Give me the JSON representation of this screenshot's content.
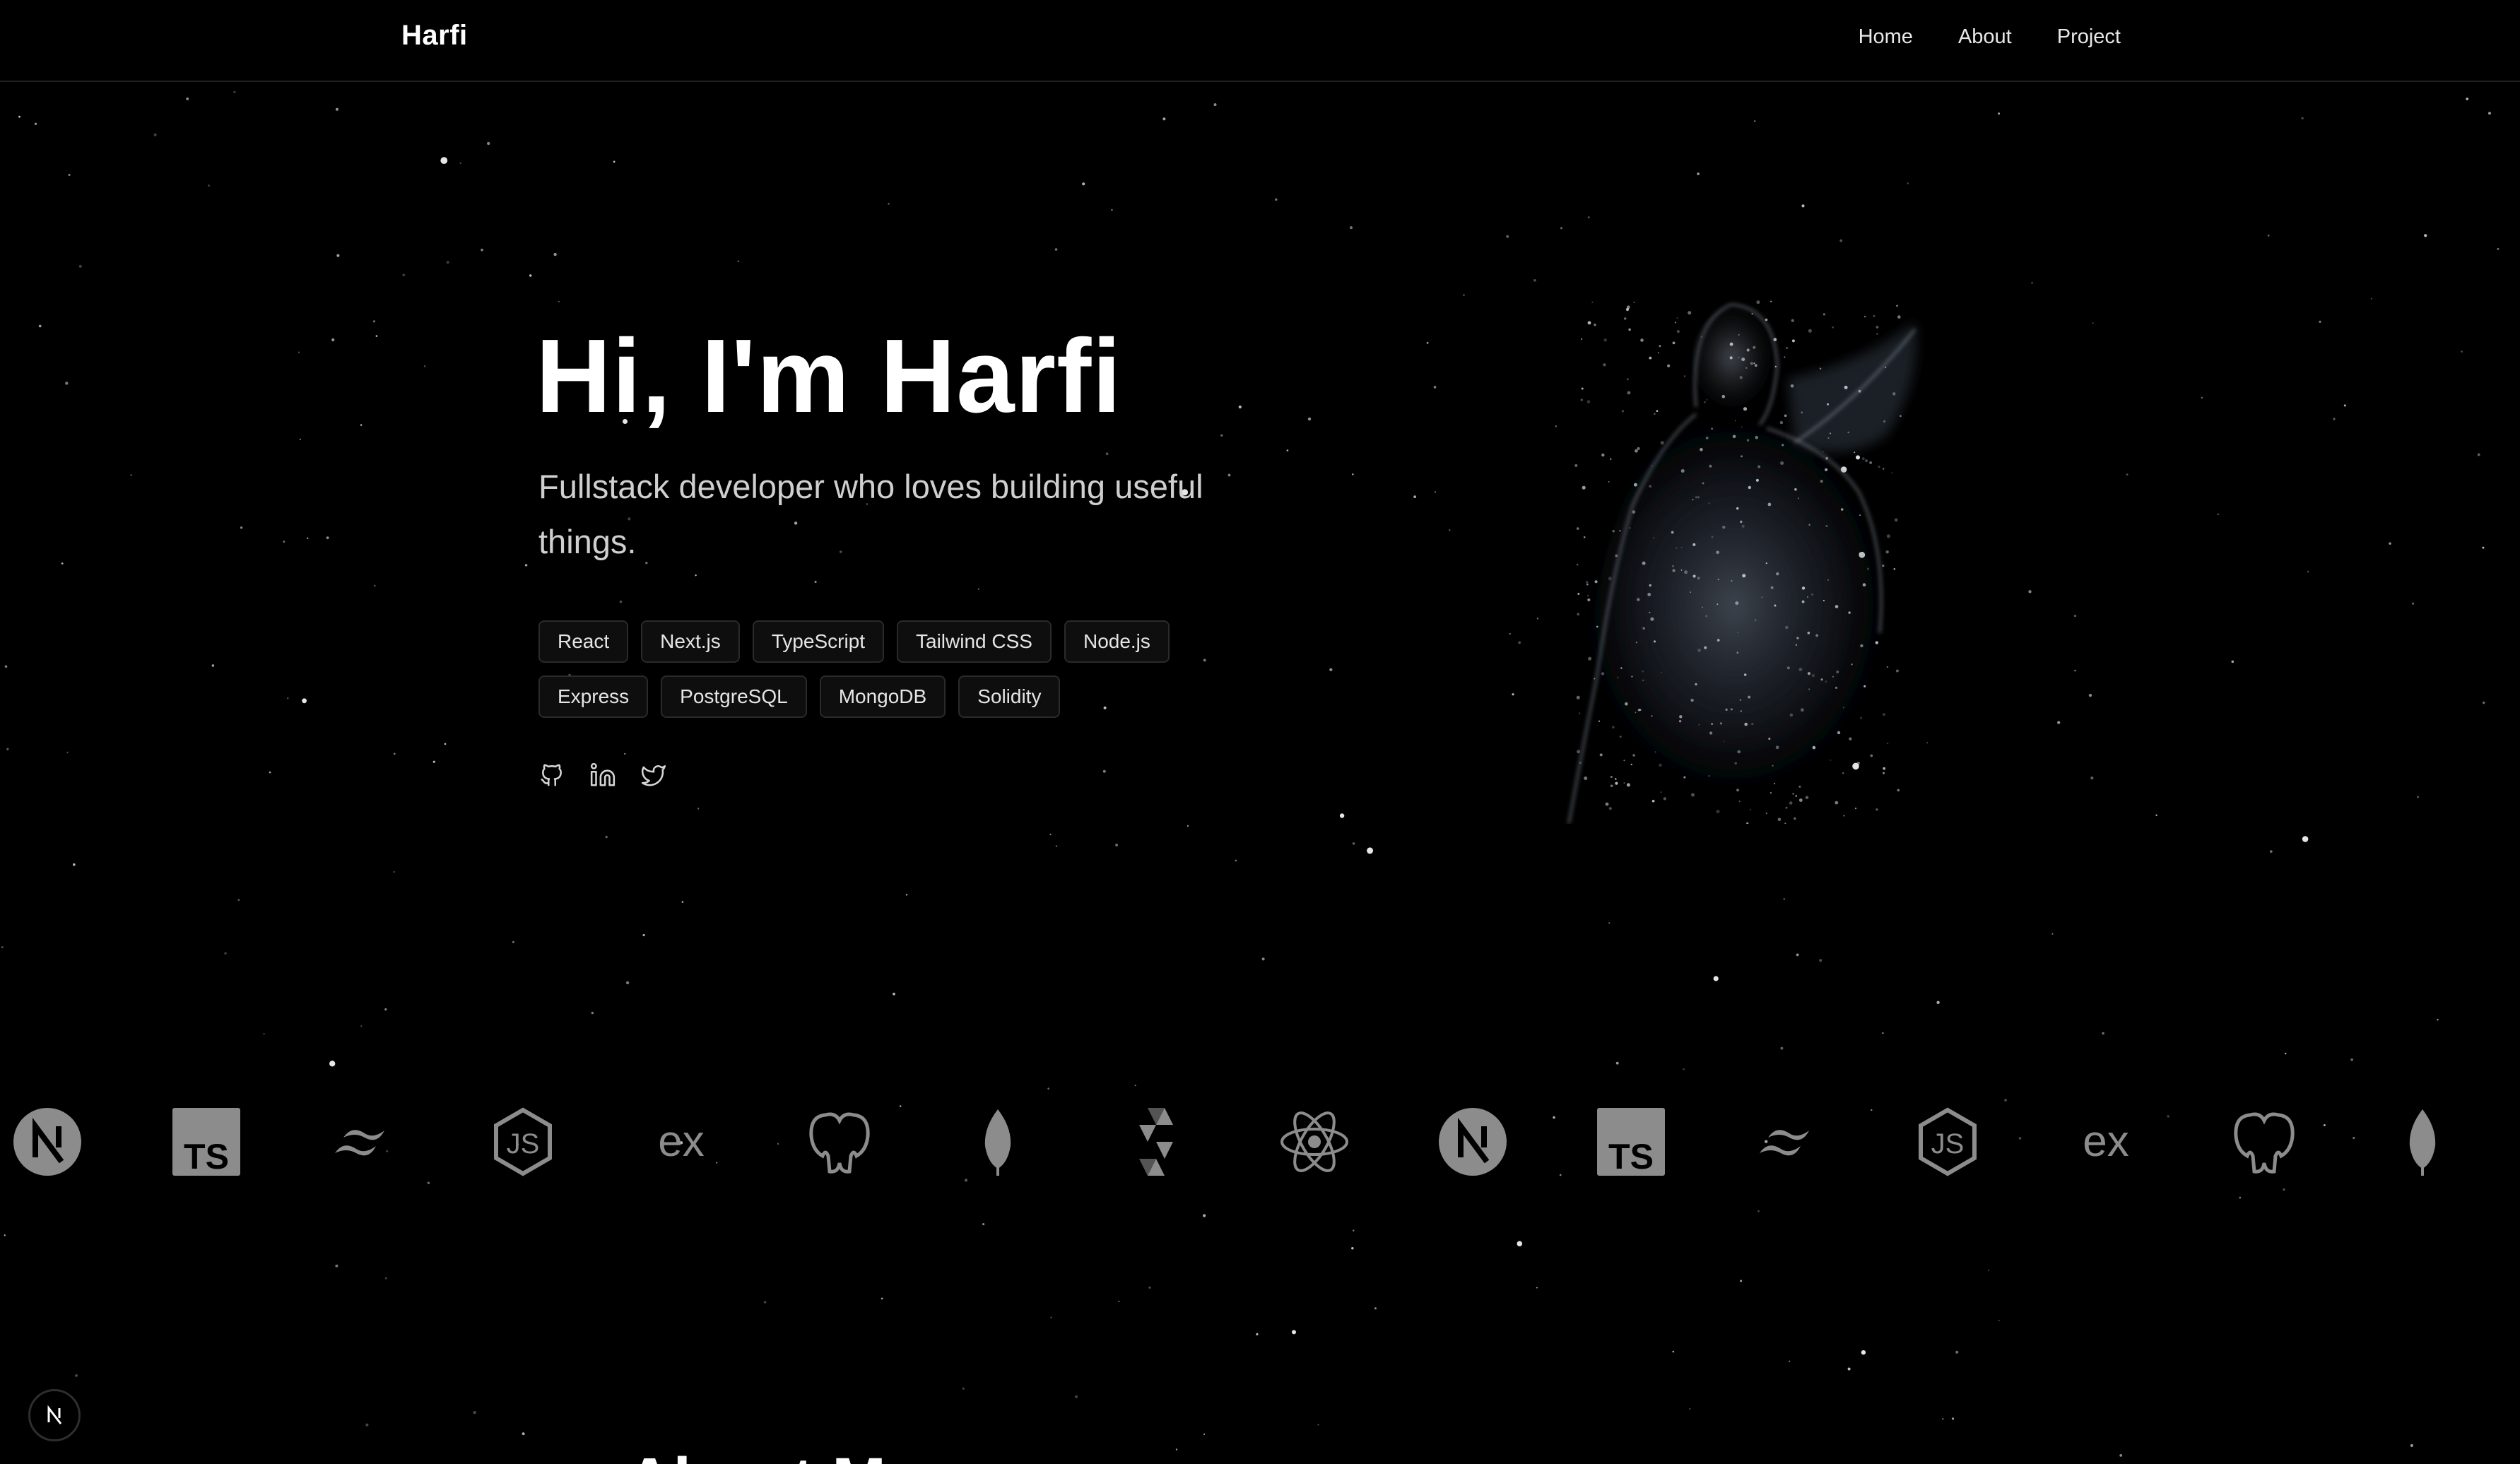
{
  "header": {
    "brand": "Harfi",
    "nav": [
      {
        "label": "Home"
      },
      {
        "label": "About"
      },
      {
        "label": "Project"
      }
    ]
  },
  "hero": {
    "title": "Hi, I'm Harfi",
    "subtitle": "Fullstack developer who loves building useful things.",
    "tags": [
      "React",
      "Next.js",
      "TypeScript",
      "Tailwind CSS",
      "Node.js",
      "Express",
      "PostgreSQL",
      "MongoDB",
      "Solidity"
    ],
    "socials": [
      {
        "icon": "github-icon"
      },
      {
        "icon": "linkedin-icon"
      },
      {
        "icon": "twitter-icon"
      }
    ]
  },
  "tech_marquee": {
    "logos": [
      "nextjs-icon",
      "typescript-icon",
      "tailwind-icon",
      "nodejs-icon",
      "express-icon",
      "postgresql-icon",
      "mongodb-icon",
      "solidity-icon",
      "react-icon",
      "nextjs-icon",
      "typescript-icon",
      "tailwind-icon",
      "nodejs-icon",
      "express-icon",
      "postgresql-icon",
      "mongodb-icon"
    ],
    "express_text": "ex",
    "typescript_text": "TS"
  },
  "about_section": {
    "heading_visible": "About M"
  },
  "colors": {
    "background": "#000000",
    "text": "#ffffff",
    "muted": "#cfcfcf",
    "tag_border": "#2a2a2a",
    "logo_gray": "#9a9a9a"
  }
}
